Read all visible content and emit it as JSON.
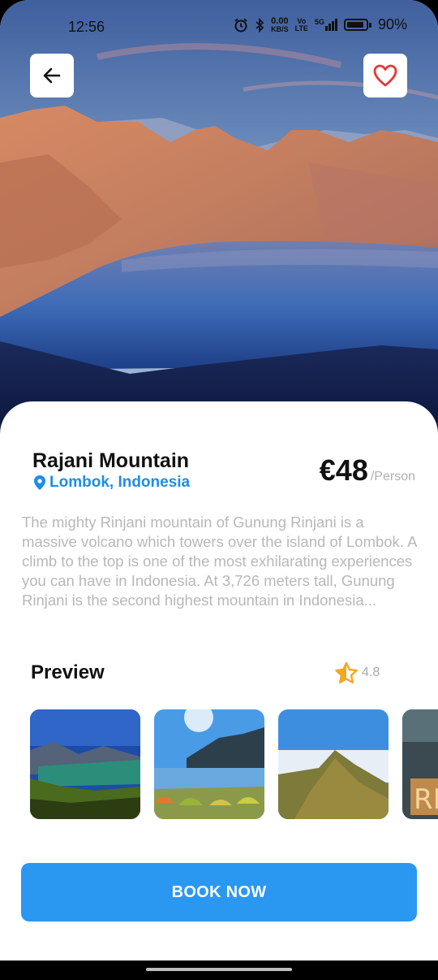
{
  "status_bar": {
    "time": "12:56",
    "speed_top": "0.00",
    "speed_bottom": "KB/S",
    "volte_top": "Vo",
    "volte_bottom": "LTE",
    "network": "5G",
    "battery": "90%"
  },
  "place": {
    "name": "Rajani Mountain",
    "location": "Lombok, Indonesia",
    "price": "€48",
    "price_unit": "/Person",
    "description": "The mighty Rinjani mountain of Gunung Rinjani is a massive volcano which towers over the island of Lombok. A climb to the top is one of the most exhilarating experiences you can have in Indonesia. At 3,726 meters tall, Gunung Rinjani is the second highest mountain in Indonesia..."
  },
  "preview": {
    "title": "Preview",
    "rating": "4.8",
    "images": [
      "crater-lake-image",
      "lakeside-camp-image",
      "ridge-clouds-image",
      "rinjani-sign-image"
    ]
  },
  "actions": {
    "book_label": "BOOK NOW"
  },
  "icons": {
    "back": "arrow-left-icon",
    "favorite": "heart-icon",
    "location": "map-pin-icon",
    "rating": "star-icon"
  },
  "colors": {
    "accent": "#2a97f0",
    "location_text": "#1e8de6",
    "favorite": "#e53935",
    "star": "#f5a623"
  }
}
